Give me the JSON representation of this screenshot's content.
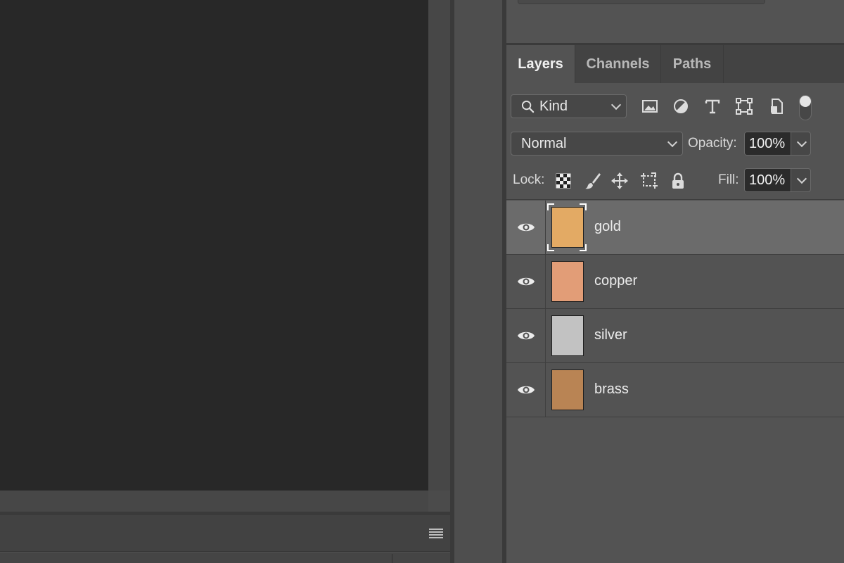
{
  "tabs": [
    {
      "label": "Layers",
      "active": true
    },
    {
      "label": "Channels",
      "active": false
    },
    {
      "label": "Paths",
      "active": false
    }
  ],
  "filter": {
    "kind_label": "Kind",
    "icons": [
      "image-filter-icon",
      "adjustment-filter-icon",
      "type-filter-icon",
      "shape-filter-icon",
      "smart-object-filter-icon"
    ]
  },
  "blend": {
    "mode": "Normal",
    "opacity_label": "Opacity:",
    "opacity_value": "100%"
  },
  "lock": {
    "label": "Lock:",
    "fill_label": "Fill:",
    "fill_value": "100%"
  },
  "layers": [
    {
      "name": "gold",
      "selected": true,
      "color": "#e3aa64"
    },
    {
      "name": "copper",
      "selected": false,
      "color": "#e29d77"
    },
    {
      "name": "silver",
      "selected": false,
      "color": "#c2c2c2"
    },
    {
      "name": "brass",
      "selected": false,
      "color": "#b98454"
    }
  ],
  "colors": {
    "canvas_bg": "#282828",
    "panel_bg": "#535353",
    "selected_row": "#6b6b6b"
  }
}
